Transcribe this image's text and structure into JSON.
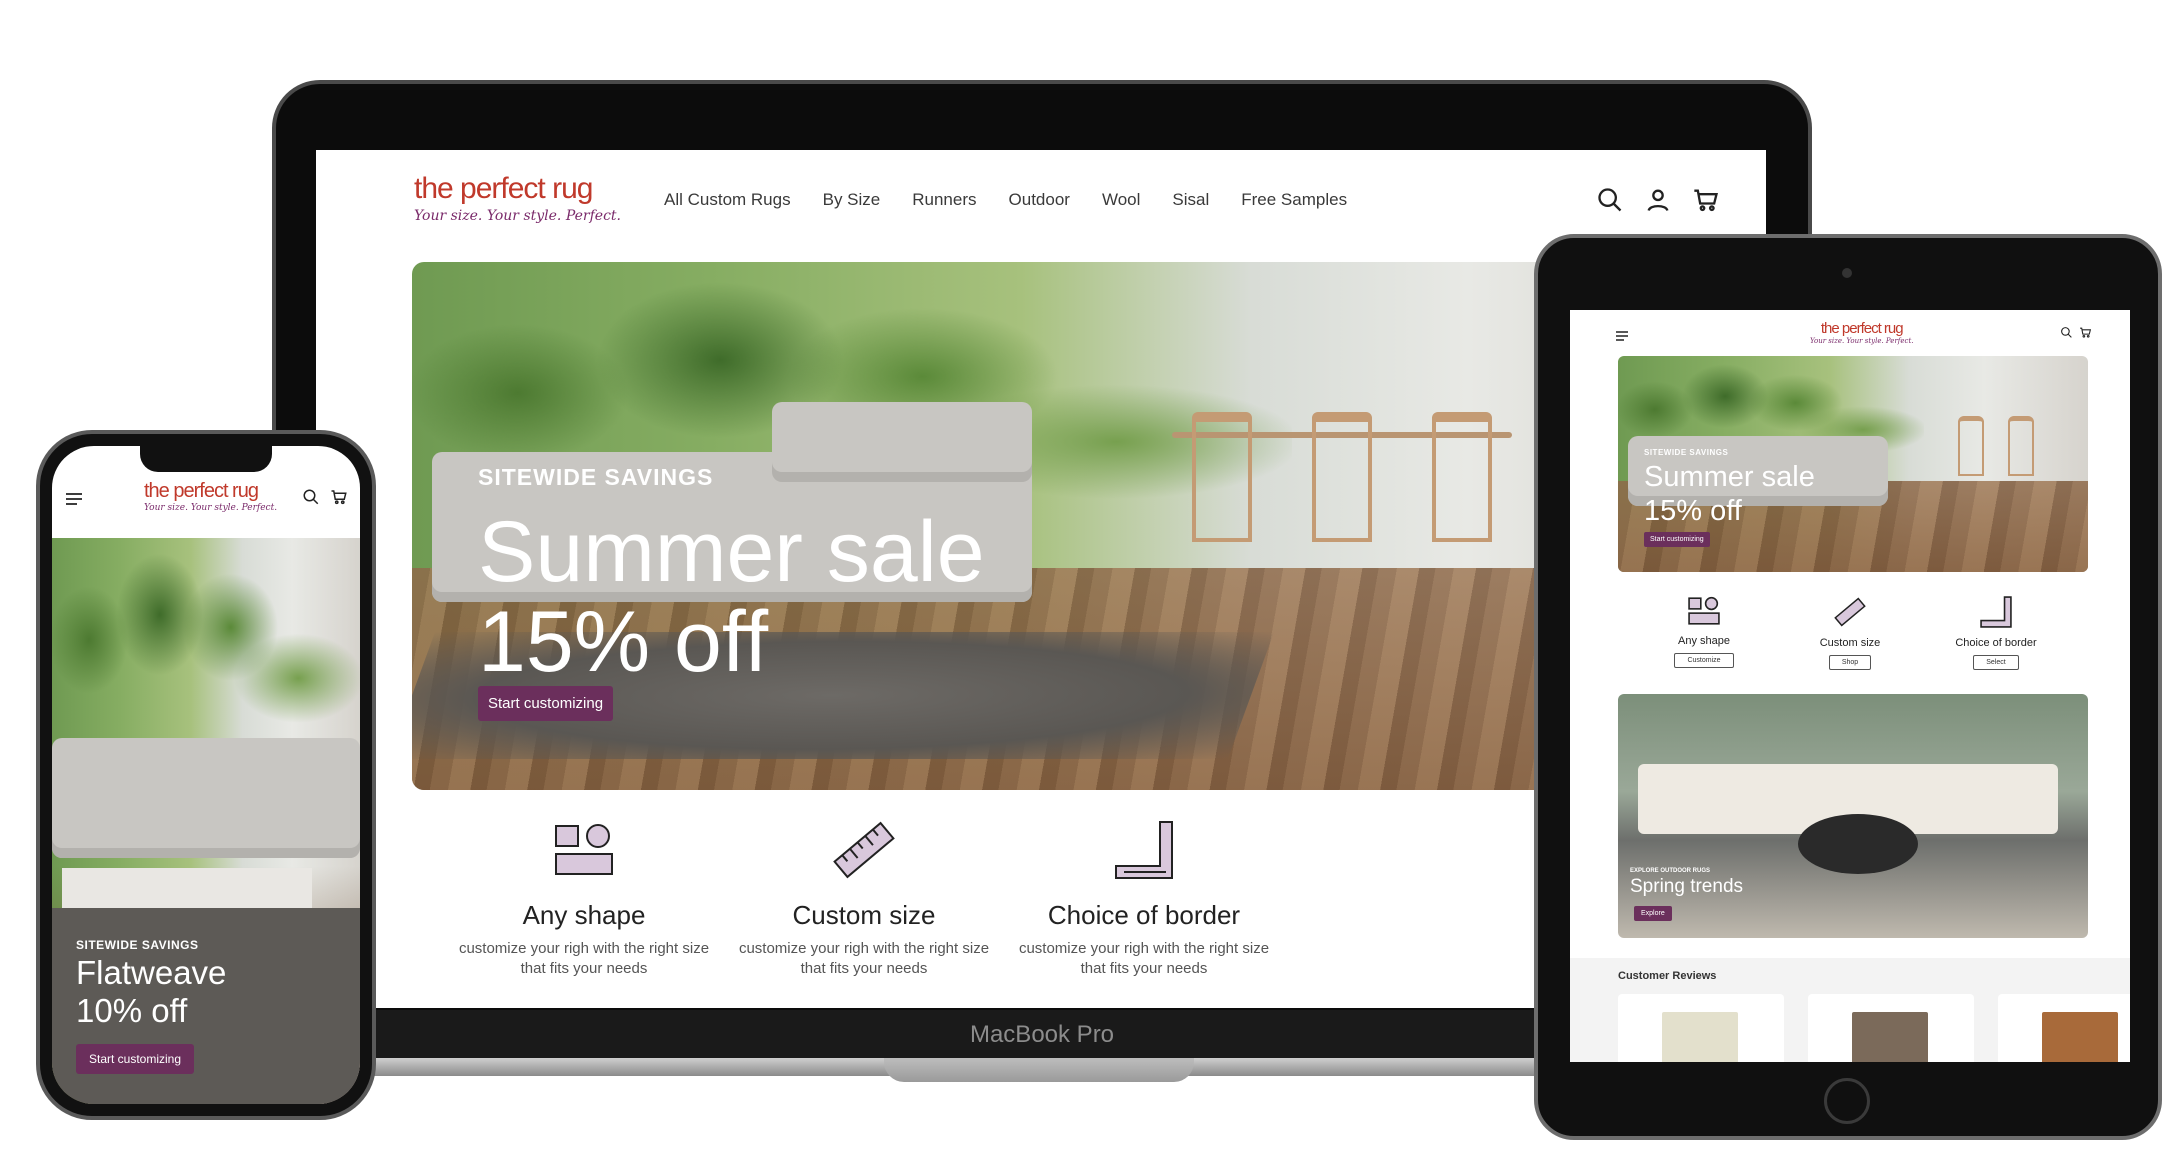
{
  "brand": {
    "name": "the perfect rug",
    "tagline": "Your size. Your style. Perfect.",
    "accent": "#6b2f5c",
    "logo_color": "#c0392b"
  },
  "laptop": {
    "device_label": "MacBook Pro",
    "nav": [
      "All Custom Rugs",
      "By Size",
      "Runners",
      "Outdoor",
      "Wool",
      "Sisal",
      "Free Samples"
    ],
    "header_icons": [
      "search-icon",
      "account-icon",
      "cart-icon"
    ],
    "hero": {
      "kicker": "SITEWIDE SAVINGS",
      "title_line1": "Summer sale",
      "title_line2": "15% off",
      "button": "Start customizing"
    },
    "features": [
      {
        "title": "Any shape",
        "desc_line1": "customize your righ with the right size",
        "desc_line2": "that fits your needs",
        "icon": "shapes-icon"
      },
      {
        "title": "Custom size",
        "desc_line1": "customize your righ with the right size",
        "desc_line2": "that fits your needs",
        "icon": "ruler-icon"
      },
      {
        "title": "Choice of border",
        "desc_line1": "customize your righ with the right size",
        "desc_line2": "that fits your needs",
        "icon": "border-icon"
      }
    ]
  },
  "tablet": {
    "hero": {
      "kicker": "SITEWIDE SAVINGS",
      "title_line1": "Summer sale",
      "title_line2": "15% off",
      "button": "Start customizing"
    },
    "features": [
      {
        "title": "Any shape",
        "button": "Customize"
      },
      {
        "title": "Custom size",
        "button": "Shop"
      },
      {
        "title": "Choice of border",
        "button": "Select"
      }
    ],
    "promo": {
      "kicker": "EXPLORE OUTDOOR RUGS",
      "title": "Spring trends",
      "button": "Explore"
    },
    "reviews_title": "Customer Reviews",
    "review_swatch_colors": [
      "#e3e0cc",
      "#7b6a5a",
      "#a86a3a"
    ]
  },
  "phone": {
    "hero": {
      "kicker": "SITEWIDE SAVINGS",
      "title_line1": "Flatweave",
      "title_line2": "10% off",
      "button": "Start customizing"
    }
  }
}
